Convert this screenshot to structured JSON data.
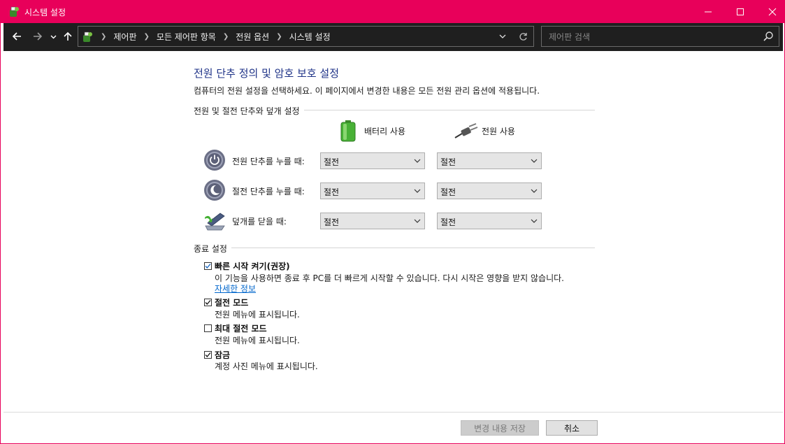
{
  "window": {
    "title": "시스템 설정",
    "accent_color": "#e8005a"
  },
  "nav": {
    "breadcrumbs": [
      "제어판",
      "모든 제어판 항목",
      "전원 옵션",
      "시스템 설정"
    ],
    "search_placeholder": "제어판 검색"
  },
  "page": {
    "heading": "전원 단추 정의 및 암호 보호 설정",
    "description": "컴퓨터의 전원 설정을 선택하세요. 이 페이지에서 변경한 내용은 모든 전원 관리 옵션에 적용됩니다."
  },
  "power_section": {
    "title": "전원 및 절전 단추와 덮개 설정",
    "col_battery": "배터리 사용",
    "col_plugged": "전원 사용",
    "rows": [
      {
        "label": "전원 단추를 누를 때:",
        "battery": "절전",
        "plugged": "절전",
        "icon": "power-button-icon"
      },
      {
        "label": "절전 단추를 누를 때:",
        "battery": "절전",
        "plugged": "절전",
        "icon": "sleep-button-icon"
      },
      {
        "label": "덮개를 닫을 때:",
        "battery": "절전",
        "plugged": "절전",
        "icon": "laptop-lid-icon"
      }
    ]
  },
  "shutdown_section": {
    "title": "종료 설정",
    "items": [
      {
        "label": "빠른 시작 켜기(권장)",
        "desc": "이 기능을 사용하면 종료 후 PC를 더 빠르게 시작할 수 있습니다. 다시 시작은 영향을 받지 않습니다.",
        "checked": true,
        "link": "자세한 정보"
      },
      {
        "label": "절전 모드",
        "desc": "전원 메뉴에 표시됩니다.",
        "checked": true
      },
      {
        "label": "최대 절전 모드",
        "desc": "전원 메뉴에 표시됩니다.",
        "checked": false
      },
      {
        "label": "잠금",
        "desc": "계정 사진 메뉴에 표시됩니다.",
        "checked": true
      }
    ]
  },
  "footer": {
    "save_label": "변경 내용 저장",
    "cancel_label": "취소"
  }
}
